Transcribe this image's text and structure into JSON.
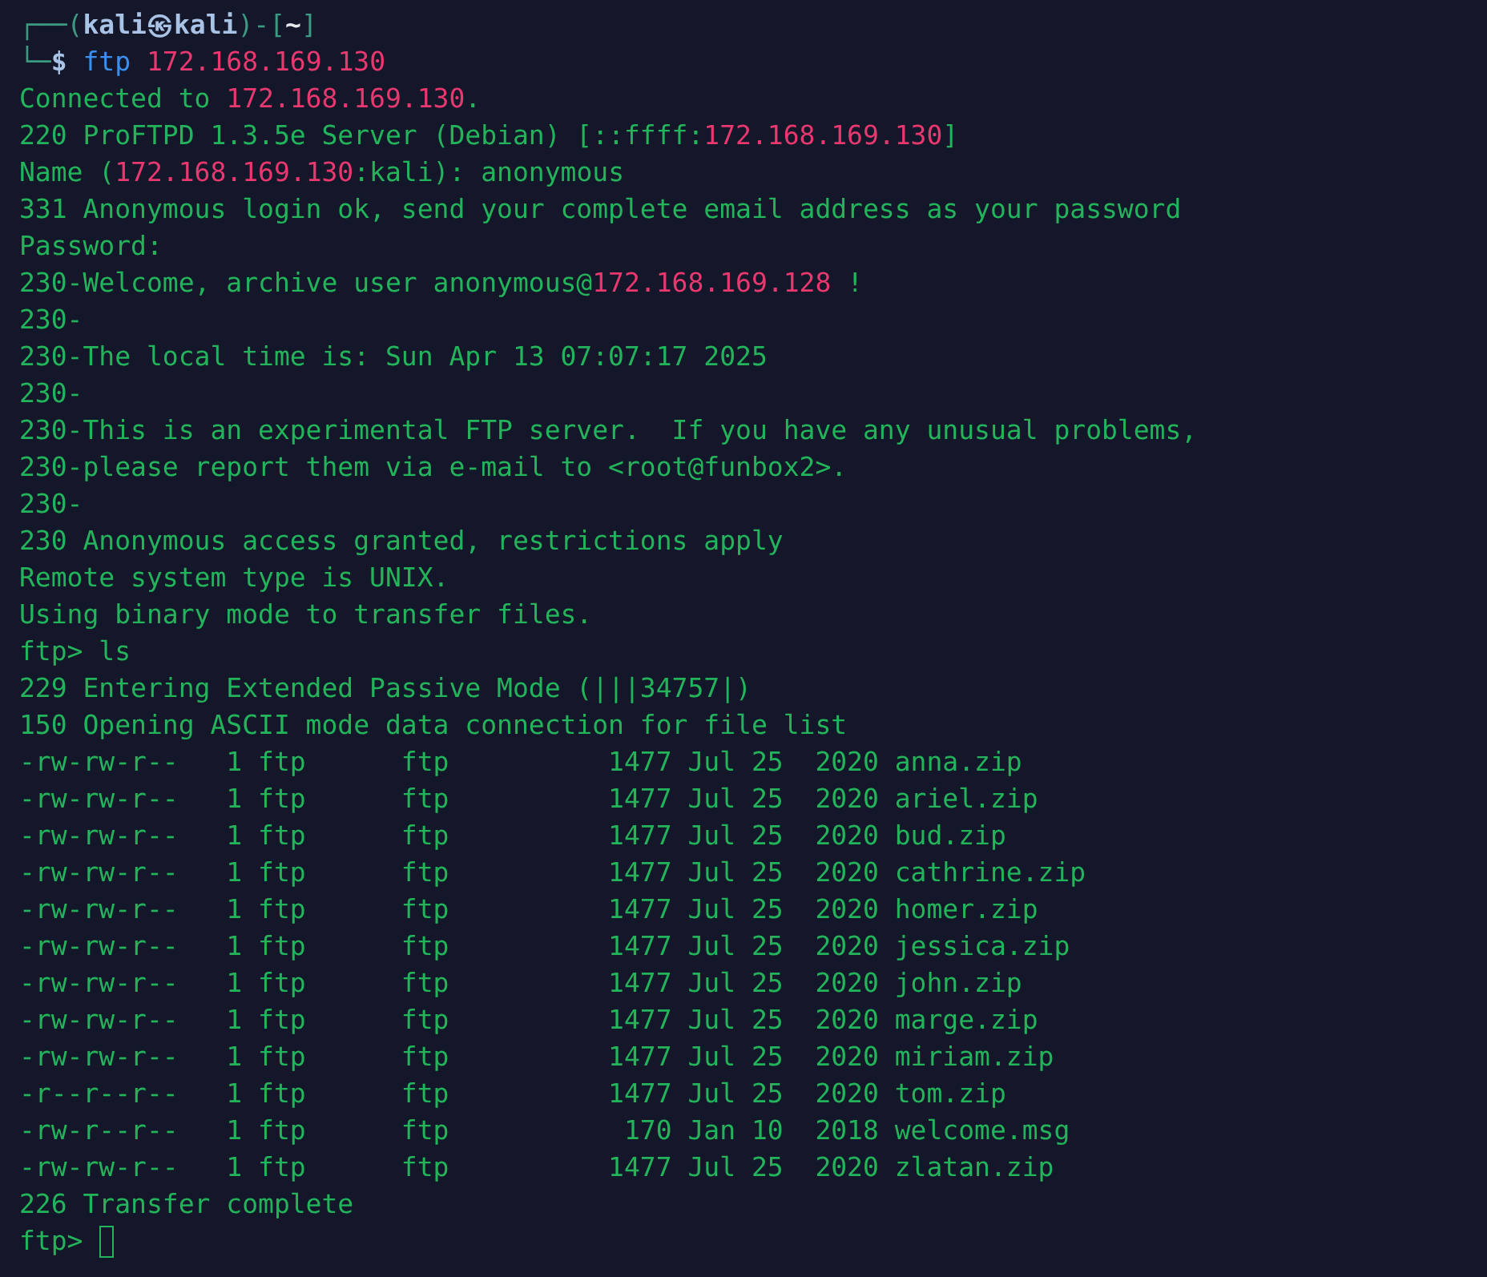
{
  "lines": [
    {
      "segments": [
        {
          "kind": "frame",
          "text": "┌──("
        },
        {
          "kind": "user",
          "text": "kali㉿kali"
        },
        {
          "kind": "frame",
          "text": ")-["
        },
        {
          "kind": "dir",
          "text": "~"
        },
        {
          "kind": "frame",
          "text": "]"
        }
      ]
    },
    {
      "segments": [
        {
          "kind": "frame",
          "text": "└─"
        },
        {
          "kind": "user",
          "text": "$ "
        },
        {
          "kind": "command",
          "text": "ftp "
        },
        {
          "kind": "address",
          "text": "172.168.169.130"
        }
      ]
    },
    {
      "segments": [
        {
          "kind": "plain",
          "text": "Connected to "
        },
        {
          "kind": "address",
          "text": "172.168.169.130"
        },
        {
          "kind": "plain",
          "text": "."
        }
      ]
    },
    {
      "segments": [
        {
          "kind": "plain",
          "text": "220 ProFTPD 1.3.5e Server (Debian) [::ffff:"
        },
        {
          "kind": "address",
          "text": "172.168.169.130"
        },
        {
          "kind": "plain",
          "text": "]"
        }
      ]
    },
    {
      "segments": [
        {
          "kind": "plain",
          "text": "Name ("
        },
        {
          "kind": "address",
          "text": "172.168.169.130"
        },
        {
          "kind": "plain",
          "text": ":kali): anonymous"
        }
      ]
    },
    {
      "segments": [
        {
          "kind": "plain",
          "text": "331 Anonymous login ok, send your complete email address as your password"
        }
      ]
    },
    {
      "segments": [
        {
          "kind": "plain",
          "text": "Password:"
        }
      ]
    },
    {
      "segments": [
        {
          "kind": "plain",
          "text": "230-Welcome, archive user anonymous@"
        },
        {
          "kind": "address",
          "text": "172.168.169.128"
        },
        {
          "kind": "plain",
          "text": " !"
        }
      ]
    },
    {
      "segments": [
        {
          "kind": "plain",
          "text": "230-"
        }
      ]
    },
    {
      "segments": [
        {
          "kind": "plain",
          "text": "230-The local time is: Sun Apr 13 07:07:17 2025"
        }
      ]
    },
    {
      "segments": [
        {
          "kind": "plain",
          "text": "230-"
        }
      ]
    },
    {
      "segments": [
        {
          "kind": "plain",
          "text": "230-This is an experimental FTP server.  If you have any unusual problems,"
        }
      ]
    },
    {
      "segments": [
        {
          "kind": "plain",
          "text": "230-please report them via e-mail to <root@funbox2>."
        }
      ]
    },
    {
      "segments": [
        {
          "kind": "plain",
          "text": "230-"
        }
      ]
    },
    {
      "segments": [
        {
          "kind": "plain",
          "text": "230 Anonymous access granted, restrictions apply"
        }
      ]
    },
    {
      "segments": [
        {
          "kind": "plain",
          "text": "Remote system type is UNIX."
        }
      ]
    },
    {
      "segments": [
        {
          "kind": "plain",
          "text": "Using binary mode to transfer files."
        }
      ]
    },
    {
      "segments": [
        {
          "kind": "plain",
          "text": "ftp> ls"
        }
      ]
    },
    {
      "segments": [
        {
          "kind": "plain",
          "text": "229 Entering Extended Passive Mode (|||34757|)"
        }
      ]
    },
    {
      "segments": [
        {
          "kind": "plain",
          "text": "150 Opening ASCII mode data connection for file list"
        }
      ]
    },
    {
      "segments": [
        {
          "kind": "plain",
          "text": "-rw-rw-r--   1 ftp      ftp          1477 Jul 25  2020 anna.zip"
        }
      ]
    },
    {
      "segments": [
        {
          "kind": "plain",
          "text": "-rw-rw-r--   1 ftp      ftp          1477 Jul 25  2020 ariel.zip"
        }
      ]
    },
    {
      "segments": [
        {
          "kind": "plain",
          "text": "-rw-rw-r--   1 ftp      ftp          1477 Jul 25  2020 bud.zip"
        }
      ]
    },
    {
      "segments": [
        {
          "kind": "plain",
          "text": "-rw-rw-r--   1 ftp      ftp          1477 Jul 25  2020 cathrine.zip"
        }
      ]
    },
    {
      "segments": [
        {
          "kind": "plain",
          "text": "-rw-rw-r--   1 ftp      ftp          1477 Jul 25  2020 homer.zip"
        }
      ]
    },
    {
      "segments": [
        {
          "kind": "plain",
          "text": "-rw-rw-r--   1 ftp      ftp          1477 Jul 25  2020 jessica.zip"
        }
      ]
    },
    {
      "segments": [
        {
          "kind": "plain",
          "text": "-rw-rw-r--   1 ftp      ftp          1477 Jul 25  2020 john.zip"
        }
      ]
    },
    {
      "segments": [
        {
          "kind": "plain",
          "text": "-rw-rw-r--   1 ftp      ftp          1477 Jul 25  2020 marge.zip"
        }
      ]
    },
    {
      "segments": [
        {
          "kind": "plain",
          "text": "-rw-rw-r--   1 ftp      ftp          1477 Jul 25  2020 miriam.zip"
        }
      ]
    },
    {
      "segments": [
        {
          "kind": "plain",
          "text": "-r--r--r--   1 ftp      ftp          1477 Jul 25  2020 tom.zip"
        }
      ]
    },
    {
      "segments": [
        {
          "kind": "plain",
          "text": "-rw-r--r--   1 ftp      ftp           170 Jan 10  2018 welcome.msg"
        }
      ]
    },
    {
      "segments": [
        {
          "kind": "plain",
          "text": "-rw-rw-r--   1 ftp      ftp          1477 Jul 25  2020 zlatan.zip"
        }
      ]
    },
    {
      "segments": [
        {
          "kind": "plain",
          "text": "226 Transfer complete"
        }
      ]
    }
  ],
  "input_line": {
    "prompt": "ftp> ",
    "cursor": true
  }
}
